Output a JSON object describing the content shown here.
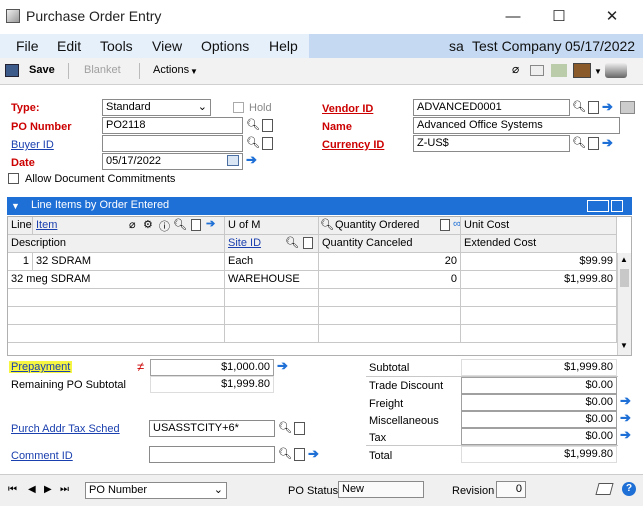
{
  "window": {
    "title": "Purchase Order Entry",
    "minimize": "—",
    "maximize": "☐",
    "close": "✕"
  },
  "menu": {
    "items": [
      "File",
      "Edit",
      "Tools",
      "View",
      "Options",
      "Help"
    ],
    "user": "sa",
    "company": "Test Company",
    "date": "05/17/2022"
  },
  "toolbar": {
    "save": "Save",
    "blanket": "Blanket",
    "actions": "Actions"
  },
  "header": {
    "type_label": "Type:",
    "type_value": "Standard",
    "hold_label": "Hold",
    "po_label": "PO Number",
    "po_value": "PO2118",
    "buyer_label": "Buyer ID",
    "buyer_value": "",
    "date_label": "Date",
    "date_value": "05/17/2022",
    "allow_label": "Allow Document Commitments",
    "vendor_label": "Vendor ID",
    "vendor_value": "ADVANCED0001",
    "name_label": "Name",
    "name_value": "Advanced Office Systems",
    "currency_label": "Currency ID",
    "currency_value": "Z-US$"
  },
  "grid": {
    "title": "Line Items by Order Entered",
    "h1": {
      "line": "Line",
      "item": "Item",
      "uom": "U of M",
      "qty_ordered": "Quantity Ordered",
      "unit_cost": "Unit Cost"
    },
    "h2": {
      "description": "Description",
      "site": "Site ID",
      "qty_canceled": "Quantity Canceled",
      "extended": "Extended Cost"
    },
    "rows": [
      {
        "line": "1",
        "item": "32 SDRAM",
        "uom": "Each",
        "qty": "20",
        "unit_cost": "$99.99",
        "description": "32 meg SDRAM",
        "site": "WAREHOUSE",
        "canceled": "0",
        "extended": "$1,999.80"
      }
    ]
  },
  "bottom": {
    "prepayment_label": "Prepayment",
    "prepayment_value": "$1,000.00",
    "remaining_label": "Remaining PO Subtotal",
    "remaining_value": "$1,999.80",
    "tax_sched_label": "Purch Addr Tax Sched",
    "tax_sched_value": "USASSTCITY+6*",
    "comment_label": "Comment ID",
    "comment_value": "",
    "subtotal_label": "Subtotal",
    "subtotal_value": "$1,999.80",
    "trade_label": "Trade Discount",
    "trade_value": "$0.00",
    "freight_label": "Freight",
    "freight_value": "$0.00",
    "misc_label": "Miscellaneous",
    "misc_value": "$0.00",
    "tax_label": "Tax",
    "tax_value": "$0.00",
    "total_label": "Total",
    "total_value": "$1,999.80"
  },
  "status": {
    "sort": "PO Number",
    "po_status_label": "PO Status",
    "po_status_value": "New",
    "revision_label": "Revision",
    "revision_value": "0"
  },
  "colors": {
    "accent": "#1e6fd6",
    "required": "#c00000",
    "link": "#1a3fae",
    "highlight": "#f5f542"
  }
}
